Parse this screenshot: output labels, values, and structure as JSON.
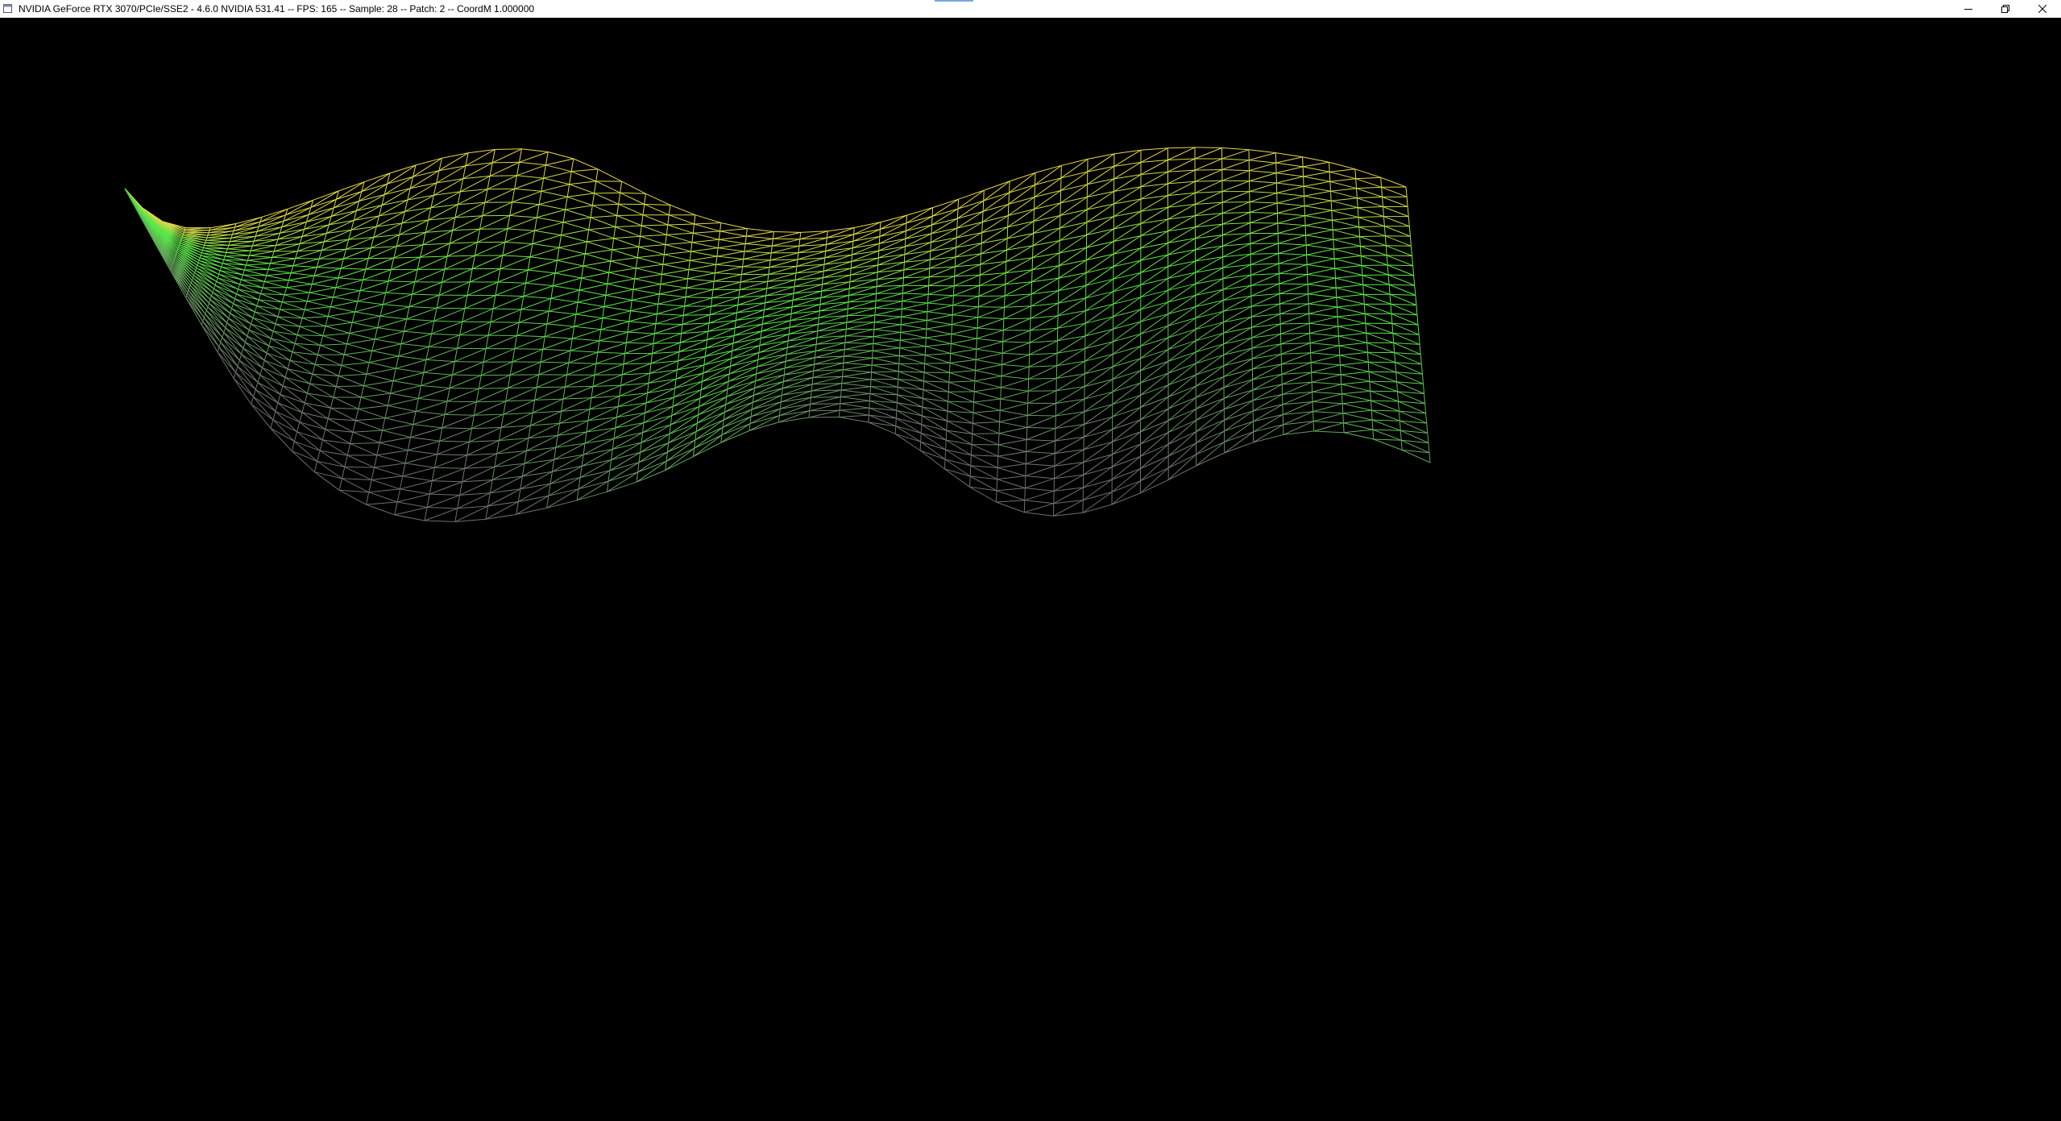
{
  "window": {
    "title": "NVIDIA GeForce RTX 3070/PCIe/SSE2 - 4.6.0 NVIDIA 531.41 -- FPS: 165 -- Sample: 28 -- Patch: 2 -- CoordM 1.000000",
    "controls": {
      "minimize_icon": "minimize-icon",
      "restore_icon": "restore-icon",
      "close_icon": "close-icon"
    }
  },
  "scene": {
    "background": "#000000",
    "render_mode": "wireframe",
    "colors": {
      "yellow": "#e8d84a",
      "green": "#5ae84a",
      "gray": "#6e6e6e"
    }
  }
}
